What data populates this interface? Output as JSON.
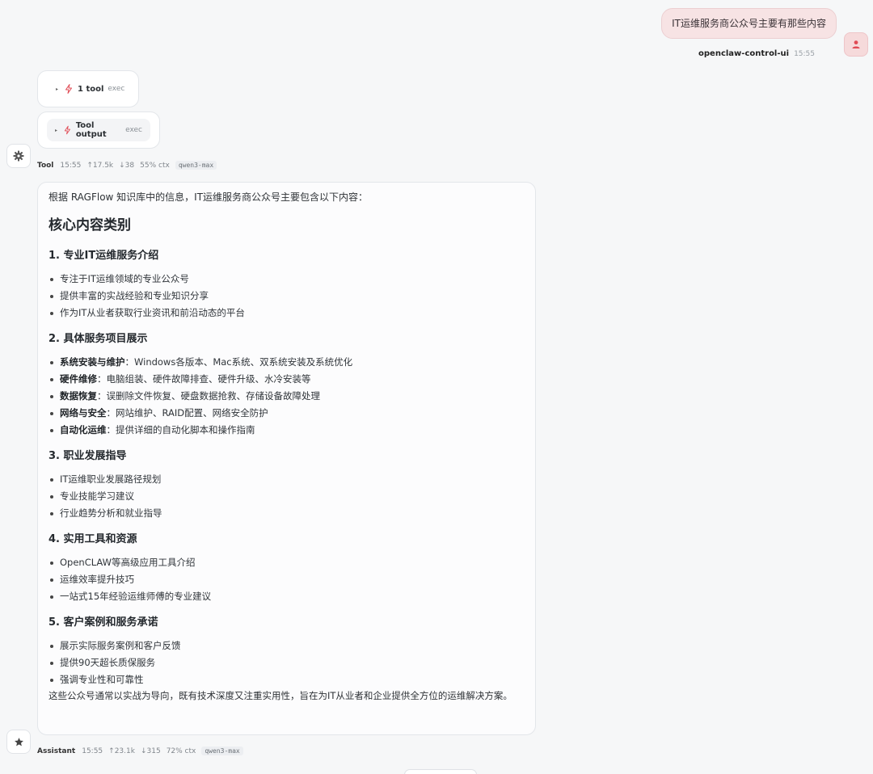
{
  "user_message": {
    "text": "IT运维服务商公众号主要有那些内容",
    "sender": "openclaw-control-ui",
    "time": "15:55",
    "avatar_icon": "user-icon"
  },
  "tool_cards": [
    {
      "name": "1 tool",
      "kind": "exec",
      "icon": "bolt-icon"
    },
    {
      "name": "Tool output",
      "kind": "exec",
      "icon": "bolt-icon"
    }
  ],
  "tool_meta": {
    "role": "Tool",
    "time": "15:55",
    "tokens_in": "↑17.5k",
    "tokens_out": "↓38",
    "ctx": "55% ctx",
    "model": "qwen3-max",
    "avatar_icon": "gear-icon"
  },
  "assistant": {
    "intro": "根据 RAGFlow 知识库中的信息，IT运维服务商公众号主要包含以下内容：",
    "heading": "核心内容类别",
    "sections": [
      {
        "title": "1. 专业IT运维服务介绍",
        "items": [
          {
            "bold": "",
            "text": "专注于IT运维领域的专业公众号"
          },
          {
            "bold": "",
            "text": "提供丰富的实战经验和专业知识分享"
          },
          {
            "bold": "",
            "text": "作为IT从业者获取行业资讯和前沿动态的平台"
          }
        ]
      },
      {
        "title": "2. 具体服务项目展示",
        "items": [
          {
            "bold": "系统安装与维护",
            "text": "：Windows各版本、Mac系统、双系统安装及系统优化"
          },
          {
            "bold": "硬件维修",
            "text": "：电脑组装、硬件故障排查、硬件升级、水冷安装等"
          },
          {
            "bold": "数据恢复",
            "text": "：误删除文件恢复、硬盘数据抢救、存储设备故障处理"
          },
          {
            "bold": "网络与安全",
            "text": "：网站维护、RAID配置、网络安全防护"
          },
          {
            "bold": "自动化运维",
            "text": "：提供详细的自动化脚本和操作指南"
          }
        ]
      },
      {
        "title": "3. 职业发展指导",
        "items": [
          {
            "bold": "",
            "text": "IT运维职业发展路径规划"
          },
          {
            "bold": "",
            "text": "专业技能学习建议"
          },
          {
            "bold": "",
            "text": "行业趋势分析和就业指导"
          }
        ]
      },
      {
        "title": "4. 实用工具和资源",
        "items": [
          {
            "bold": "",
            "text": "OpenCLAW等高级应用工具介绍"
          },
          {
            "bold": "",
            "text": "运维效率提升技巧"
          },
          {
            "bold": "",
            "text": "一站式15年经验运维师傅的专业建议"
          }
        ]
      },
      {
        "title": "5. 客户案例和服务承诺",
        "items": [
          {
            "bold": "",
            "text": "展示实际服务案例和客户反馈"
          },
          {
            "bold": "",
            "text": "提供90天超长质保服务"
          },
          {
            "bold": "",
            "text": "强调专业性和可靠性"
          }
        ]
      }
    ],
    "conclusion": "这些公众号通常以实战为导向，既有技术深度又注重实用性，旨在为IT从业者和企业提供全方位的运维解决方案。"
  },
  "assistant_meta": {
    "role": "Assistant",
    "time": "15:55",
    "tokens_in": "↑23.1k",
    "tokens_out": "↓315",
    "ctx": "72% ctx",
    "model": "qwen3-max",
    "avatar_icon": "star-icon"
  },
  "colors": {
    "accent": "#e04b55",
    "user_bubble": "#f7e3e4",
    "background": "#f6f7f8"
  }
}
